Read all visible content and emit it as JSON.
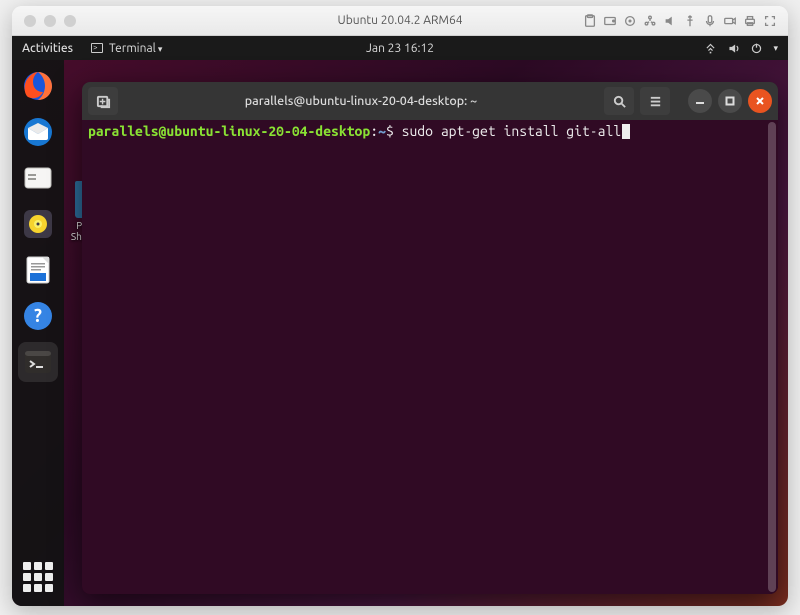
{
  "vm": {
    "title": "Ubuntu 20.04.2 ARM64"
  },
  "gnome": {
    "activities": "Activities",
    "app_name": "Terminal",
    "clock": "Jan 23  16:12"
  },
  "dock": {
    "items": [
      {
        "name": "firefox"
      },
      {
        "name": "thunderbird"
      },
      {
        "name": "files"
      },
      {
        "name": "rhythmbox"
      },
      {
        "name": "libreoffice-writer"
      },
      {
        "name": "help"
      },
      {
        "name": "terminal"
      }
    ]
  },
  "desktop": {
    "folder_label": "Parallels Shared F…"
  },
  "terminal": {
    "title": "parallels@ubuntu-linux-20-04-desktop: ~",
    "prompt_user_host": "parallels@ubuntu-linux-20-04-desktop",
    "prompt_separator": ":",
    "prompt_path": "~",
    "prompt_symbol": "$",
    "command": "sudo apt-get install git-all"
  },
  "colors": {
    "ubuntu_orange": "#e95420",
    "terminal_bg": "#300a24",
    "prompt_green": "#8ae234",
    "prompt_blue": "#729fcf"
  }
}
